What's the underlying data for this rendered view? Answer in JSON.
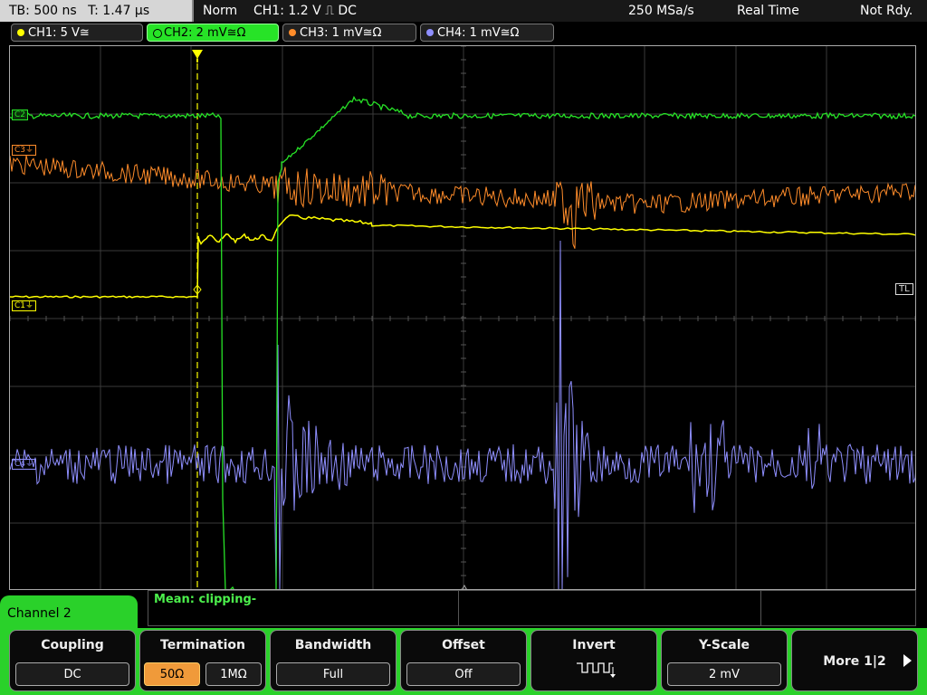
{
  "topbar": {
    "timebase": "TB: 500 ns",
    "trigger_time": "T: 1.47 µs",
    "mode": "Norm",
    "trigger_source": "CH1: 1.2 V ⎍ DC",
    "sample_rate": "250 MSa/s",
    "acq_mode": "Real Time",
    "status": "Not Rdy."
  },
  "channels": [
    {
      "label": "CH1: 5 V≅",
      "color": "#ffff00",
      "active": false
    },
    {
      "label": "CH2: 2 mV≅Ω",
      "color": "#27e327",
      "active": true
    },
    {
      "label": "CH3: 1 mV≅Ω",
      "color": "#ff8c2a",
      "active": false
    },
    {
      "label": "CH4: 1 mV≅Ω",
      "color": "#8f8fff",
      "active": false
    }
  ],
  "markers": {
    "c2": "C2",
    "c3": "C3⏚",
    "c1": "C1⏚",
    "c4": "C4⏚",
    "tl": "TL"
  },
  "measurement": {
    "text": "Mean: clipping-"
  },
  "channel_panel": {
    "title": "Channel 2"
  },
  "softkeys": {
    "coupling": {
      "title": "Coupling",
      "value": "DC"
    },
    "termination": {
      "title": "Termination",
      "opt1": "50Ω",
      "opt2": "1MΩ"
    },
    "bandwidth": {
      "title": "Bandwidth",
      "value": "Full"
    },
    "offset": {
      "title": "Offset",
      "value": "Off"
    },
    "invert": {
      "title": "Invert"
    },
    "yscale": {
      "title": "Y-Scale",
      "value": "2 mV"
    },
    "more": {
      "title": "More 1|2"
    }
  }
}
